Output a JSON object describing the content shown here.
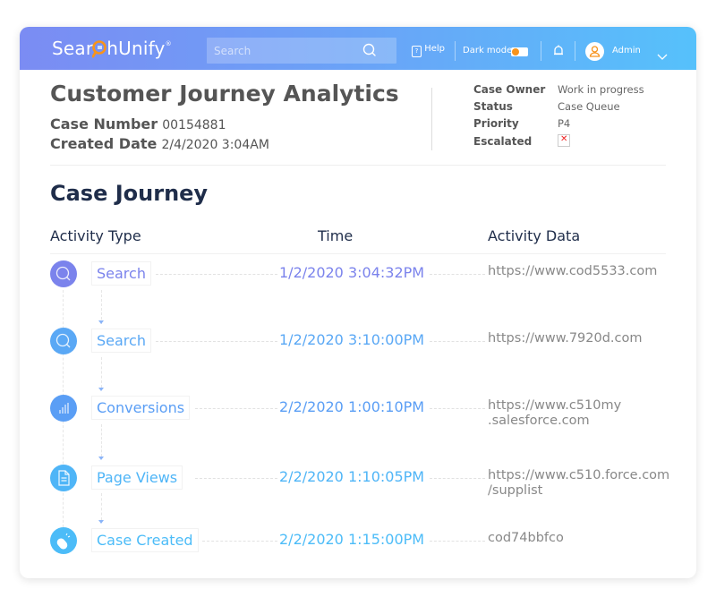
{
  "header": {
    "logo_text_before": "Sear",
    "logo_text_after": "hUnify",
    "logo_mark": "®",
    "search_placeholder": "Search",
    "help_label": "Help",
    "dark_mode_label": "Dark mode",
    "dark_mode_on": false,
    "user_name": "Admin",
    "gradient_colors": [
      "#7b8cf3",
      "#56c1fb"
    ],
    "toggle_color": "#f7941d"
  },
  "case": {
    "title": "Customer Journey Analytics",
    "case_number_label": "Case Number",
    "case_number": "00154881",
    "created_date_label": "Created Date",
    "created_date": "2/4/2020 3:04AM",
    "details": [
      {
        "label": "Case Owner",
        "value": "Work in progress"
      },
      {
        "label": "Status",
        "value": "Case Queue"
      },
      {
        "label": "Priority",
        "value": "P4"
      },
      {
        "label": "Escalated",
        "value": ""
      }
    ],
    "escalated": false
  },
  "journey": {
    "title": "Case Journey",
    "columns": [
      "Activity Type",
      "Time",
      "Activity Data"
    ],
    "rows": [
      {
        "type": "Search",
        "icon": "search-icon",
        "color": "#7b83ec",
        "time": "1/2/2020  3:04:32PM",
        "data_line1": "https://www.cod5533.com",
        "data_line2": ""
      },
      {
        "type": "Search",
        "icon": "search-icon",
        "color": "#5aa8f5",
        "time": "1/2/2020  3:10:00PM",
        "data_line1": "https://www.7920d.com",
        "data_line2": ""
      },
      {
        "type": "Conversions",
        "icon": "bar-chart-icon",
        "color": "#5a9ef5",
        "time": "2/2/2020  1:00:10PM",
        "data_line1": "https://www.c510my",
        "data_line2": ".salesforce.com"
      },
      {
        "type": "Page Views",
        "icon": "document-icon",
        "color": "#4fb5f7",
        "time": "2/2/2020  1:10:05PM",
        "data_line1": "https://www.c510.force.com",
        "data_line2": "/supplist"
      },
      {
        "type": "Case Created",
        "icon": "mouse-click-icon",
        "color": "#4cbcf8",
        "time": "2/2/2020  1:15:00PM",
        "data_line1": "cod74bbfco",
        "data_line2": ""
      }
    ]
  }
}
